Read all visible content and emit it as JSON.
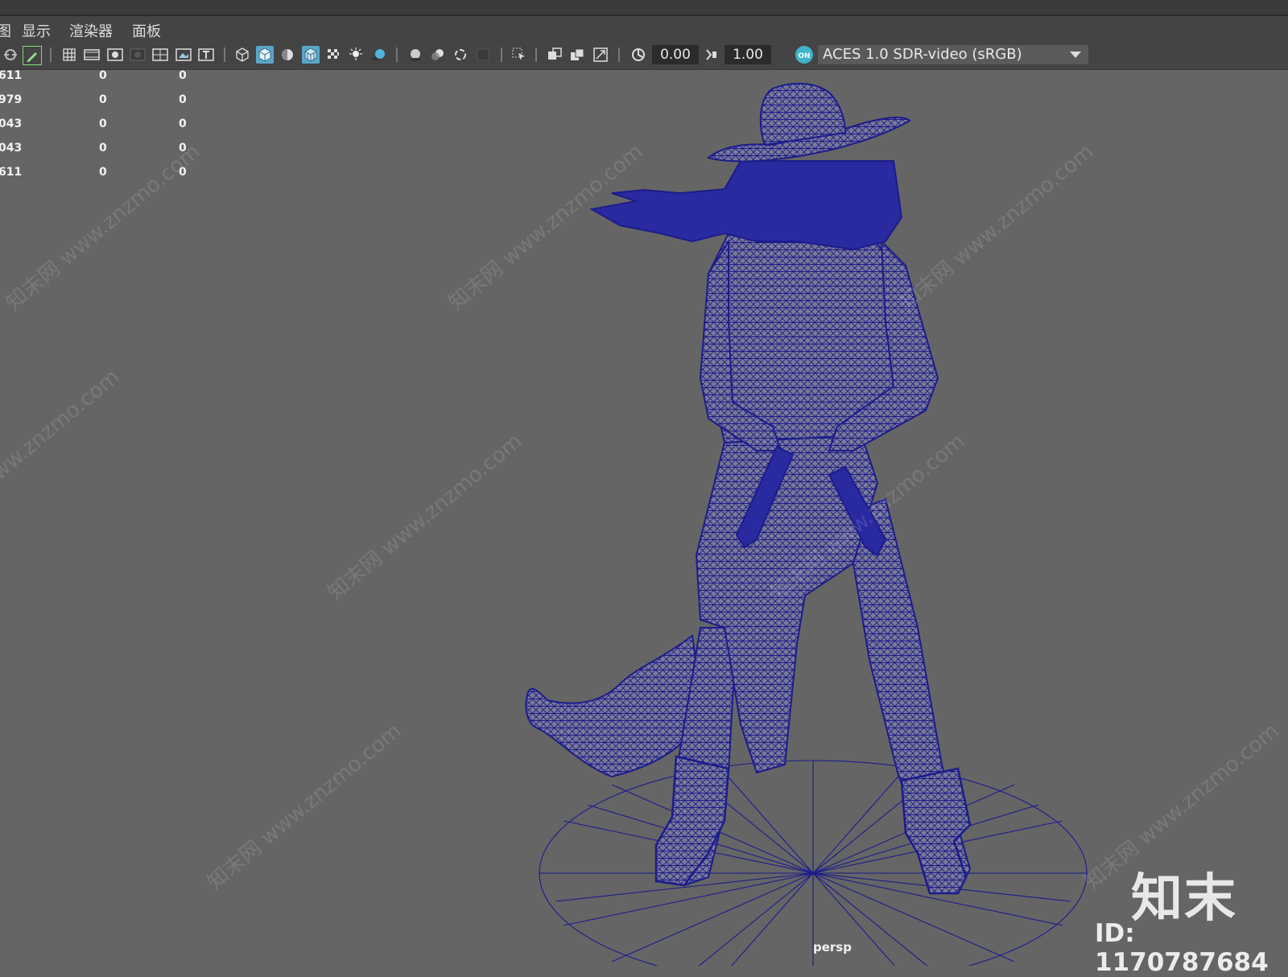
{
  "menu": {
    "partial": "图",
    "items": [
      "显示",
      "渲染器",
      "面板"
    ]
  },
  "toolbar": {
    "exposure": "0.00",
    "gamma": "1.00",
    "color_space": "ACES 1.0 SDR-video (sRGB)",
    "colors": {
      "highlight": "#5aa6c8",
      "field_bg": "#2b2b2b"
    },
    "icons": [
      "camera-tool-icon",
      "pencil-icon",
      "grid-icon",
      "film-gate-icon",
      "resolution-gate-icon",
      "gate-mask-icon",
      "field-chart-icon",
      "safe-action-icon",
      "safe-title-icon",
      "wireframe-icon",
      "smooth-shade-icon",
      "default-material-icon",
      "wireframe-on-shaded-icon",
      "xray-icon",
      "lights-icon",
      "shadows-icon",
      "screen-space-ao-icon",
      "motion-blur-icon",
      "anti-alias-icon",
      "depth-of-field-icon",
      "isolate-select-icon",
      "xray-joints-icon",
      "xray-active-icon",
      "backface-icon",
      "exposure-icon",
      "gamma-icon",
      "color-management-icon"
    ]
  },
  "hud": {
    "rows": [
      {
        "a": "611",
        "b": "0",
        "c": "0"
      },
      {
        "a": "979",
        "b": "0",
        "c": "0"
      },
      {
        "a": "043",
        "b": "0",
        "c": "0"
      },
      {
        "a": "043",
        "b": "0",
        "c": "0"
      },
      {
        "a": "611",
        "b": "0",
        "c": "0"
      }
    ]
  },
  "viewport": {
    "camera": "persp",
    "model_icon": "wireframe-cowgirl-figure-icon",
    "wire_color": "#1c1c8c"
  },
  "watermark": {
    "logo": "知末",
    "id": "ID: 1170787684",
    "repeat_text": "知末网 www.znzmo.com"
  }
}
